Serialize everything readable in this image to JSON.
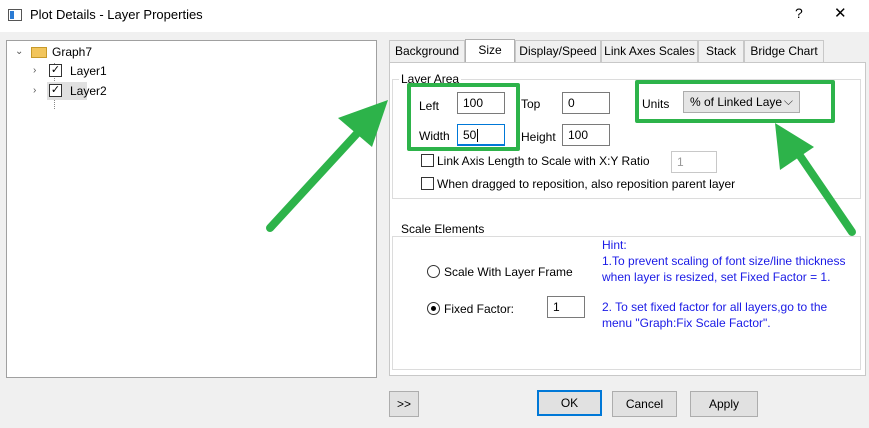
{
  "window": {
    "title": "Plot Details - Layer Properties",
    "help_label": "?",
    "close_label": "✕"
  },
  "tree": {
    "root": {
      "label": "Graph7",
      "checked": false
    },
    "items": [
      {
        "label": "Layer1",
        "checked": true
      },
      {
        "label": "Layer2",
        "checked": true,
        "selected": true
      }
    ]
  },
  "tabs": [
    {
      "label": "Background",
      "active": false
    },
    {
      "label": "Size",
      "active": true
    },
    {
      "label": "Display/Speed",
      "active": false
    },
    {
      "label": "Link Axes Scales",
      "active": false
    },
    {
      "label": "Stack",
      "active": false
    },
    {
      "label": "Bridge Chart",
      "active": false
    }
  ],
  "layer_area": {
    "legend": "Layer Area",
    "left_label": "Left",
    "left_value": "100",
    "top_label": "Top",
    "top_value": "0",
    "width_label": "Width",
    "width_value": "50",
    "height_label": "Height",
    "height_value": "100",
    "units_label": "Units",
    "units_value": "% of Linked Laye",
    "link_axis_label": "Link Axis Length to Scale with X:Y Ratio",
    "link_axis_value": "1",
    "reposition_label": "When dragged to reposition, also reposition parent layer"
  },
  "scale_elements": {
    "legend": "Scale Elements",
    "scale_with_frame_label": "Scale With Layer Frame",
    "fixed_factor_label": "Fixed Factor:",
    "fixed_factor_value": "1",
    "selected": "fixed_factor",
    "hint": {
      "title": "Hint:",
      "line1": "1.To prevent scaling of font size/line thickness",
      "line2": "when layer is resized, set Fixed Factor = 1.",
      "line3": "2. To set fixed factor for all layers,go to the",
      "line4": "menu \"Graph:Fix Scale Factor\"."
    }
  },
  "footer": {
    "expand_label": ">>",
    "ok_label": "OK",
    "cancel_label": "Cancel",
    "apply_label": "Apply"
  },
  "colors": {
    "annotation": "#2db34a",
    "hint_text": "#1a1ae6",
    "focus": "#0078d7"
  },
  "icons": {
    "folder": "folder-open-icon",
    "expand": "chevron-down-icon",
    "collapse": "chevron-right-icon"
  }
}
